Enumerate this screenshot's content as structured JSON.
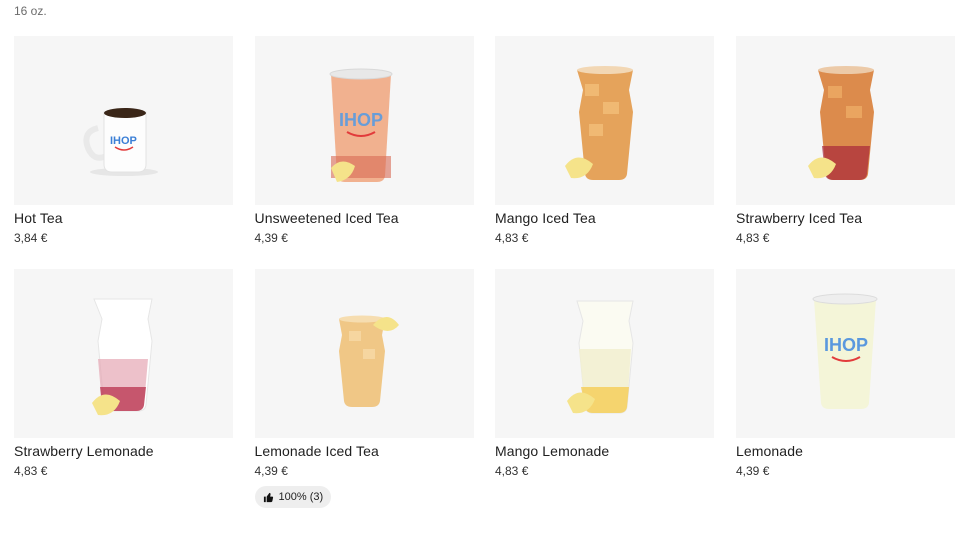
{
  "header": {
    "previous_size_text": "16 oz."
  },
  "menu_items": [
    {
      "name": "Hot Tea",
      "price": "3,84 €",
      "image_icon": "hot-tea-mug-icon"
    },
    {
      "name": "Unsweetened Iced Tea",
      "price": "4,39 €",
      "image_icon": "iced-tea-cup-icon"
    },
    {
      "name": "Mango Iced Tea",
      "price": "4,83 €",
      "image_icon": "mango-iced-tea-glass-icon"
    },
    {
      "name": "Strawberry Iced Tea",
      "price": "4,83 €",
      "image_icon": "strawberry-iced-tea-glass-icon"
    },
    {
      "name": "Strawberry Lemonade",
      "price": "4,83 €",
      "image_icon": "strawberry-lemonade-glass-icon"
    },
    {
      "name": "Lemonade Iced Tea",
      "price": "4,39 €",
      "image_icon": "lemonade-iced-tea-glass-icon",
      "rating": "100% (3)"
    },
    {
      "name": "Mango Lemonade",
      "price": "4,83 €",
      "image_icon": "mango-lemonade-glass-icon"
    },
    {
      "name": "Lemonade",
      "price": "4,39 €",
      "image_icon": "lemonade-cup-icon"
    }
  ],
  "colors": {
    "tile_bg": "#f6f6f6",
    "ihop_blue": "#3b7fd6",
    "ihop_red": "#e23b3b",
    "tea": "#d9803a",
    "lemon": "#f2d96a"
  }
}
